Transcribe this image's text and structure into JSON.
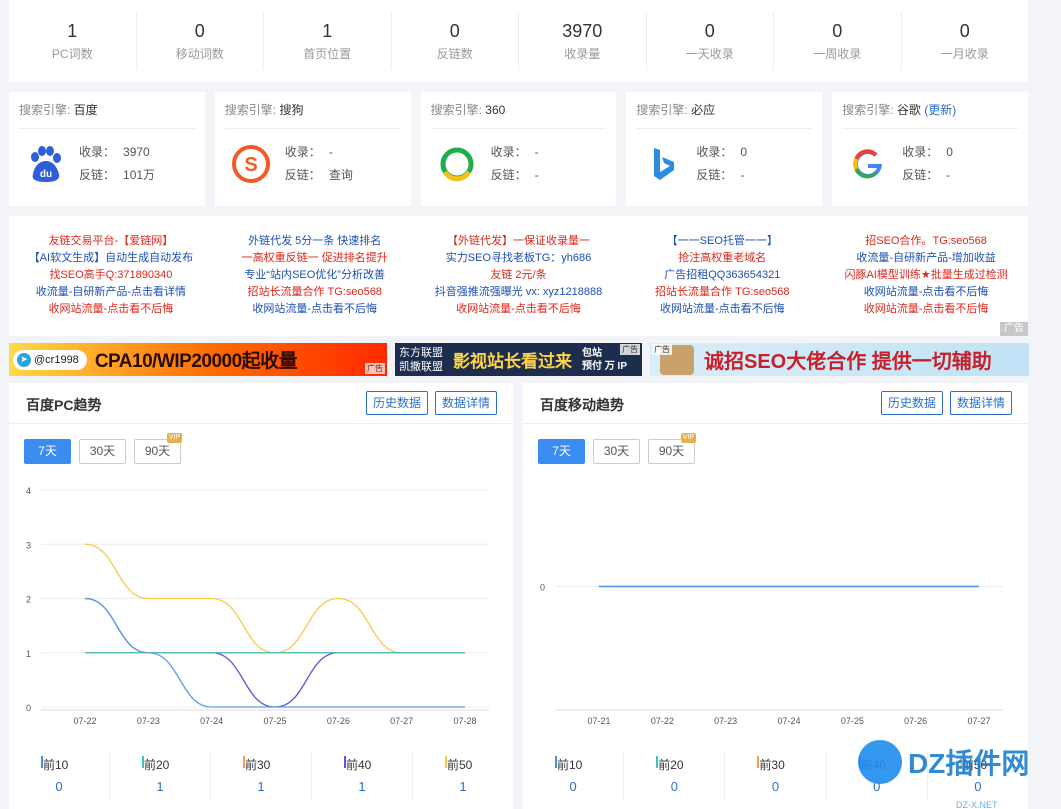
{
  "stats": [
    {
      "value": "1",
      "label": "PC词数"
    },
    {
      "value": "0",
      "label": "移动词数"
    },
    {
      "value": "1",
      "label": "首页位置"
    },
    {
      "value": "0",
      "label": "反链数"
    },
    {
      "value": "3970",
      "label": "收录量"
    },
    {
      "value": "0",
      "label": "一天收录"
    },
    {
      "value": "0",
      "label": "一周收录"
    },
    {
      "value": "0",
      "label": "一月收录"
    }
  ],
  "engines": [
    {
      "prefix": "搜索引擎: ",
      "name": "百度",
      "extra": "",
      "k1": "收录：",
      "v1": "3970",
      "k2": "反链：",
      "v2": "101万",
      "icon": "baidu-icon"
    },
    {
      "prefix": "搜索引擎: ",
      "name": "搜狗",
      "extra": "",
      "k1": "收录：",
      "v1": "-",
      "k2": "反链：",
      "v2": "查询",
      "icon": "sogou-icon"
    },
    {
      "prefix": "搜索引擎: ",
      "name": "360",
      "extra": "",
      "k1": "收录：",
      "v1": "-",
      "k2": "反链：",
      "v2": "-",
      "icon": "so360-icon"
    },
    {
      "prefix": "搜索引擎: ",
      "name": "必应",
      "extra": "",
      "k1": "收录：",
      "v1": "0",
      "k2": "反链：",
      "v2": "-",
      "icon": "bing-icon"
    },
    {
      "prefix": "搜索引擎: ",
      "name": "谷歌",
      "extra": "(更新)",
      "k1": "收录：",
      "v1": "0",
      "k2": "反链：",
      "v2": "-",
      "icon": "google-icon"
    }
  ],
  "ad_columns": [
    [
      "友链交易平台-【爱链网】",
      "【AI软文生成】自动生成自动发布",
      "找SEO高手Q:371890340",
      "收流量-自研新产品-点击看详情",
      "收网站流量-点击看不后悔"
    ],
    [
      "外链代发 5分一条 快速排名",
      "一高权重反链一 促进排名提升",
      "专业“站内SEO优化”分析改善",
      "招站长流量合作 TG:seo568",
      "收网站流量-点击看不后悔"
    ],
    [
      "【外链代发】一保证收录量一",
      "实力SEO寻找老板TG：yh686",
      "友链 2元/条",
      "抖音强推流强曝光 vx: xyz1218888",
      "收网站流量-点击看不后悔"
    ],
    [
      "【一一SEO托管一一】",
      "抢注高权重老域名",
      "广告招租QQ363654321",
      "招站长流量合作 TG:seo568",
      "收网站流量-点击看不后悔"
    ],
    [
      "招SEO合作。TG:seo568",
      "收流量-自研新产品-增加收益",
      "闪豚AI模型训练★批量生成过检测",
      "收网站流量-点击看不后悔",
      "收网站流量-点击看不后悔"
    ]
  ],
  "ad_colors": [
    [
      "#e0261b",
      "#1c4fb4",
      "#e0261b",
      "#1c4fb4",
      "#e0261b"
    ],
    [
      "#1c4fb4",
      "#e0261b",
      "#1c4fb4",
      "#e0261b",
      "#1c4fb4"
    ],
    [
      "#e0261b",
      "#1c4fb4",
      "#e0261b",
      "#1c4fb4",
      "#e0261b"
    ],
    [
      "#1c4fb4",
      "#e0261b",
      "#1c4fb4",
      "#e0261b",
      "#1c4fb4"
    ],
    [
      "#e0261b",
      "#1c4fb4",
      "#e0261b",
      "#1c4fb4",
      "#e0261b"
    ]
  ],
  "ad_tag": "广告",
  "banners": {
    "b1_pill": "@cr1998",
    "b1_text": "CPA10/WIP20000起收量",
    "b1_tag": "广告",
    "b2_left1": "东方联盟",
    "b2_left2": "凯撒联盟",
    "b2_mid": "影视站长看过来",
    "b2_right1": "包站",
    "b2_right2": "预付 万 IP",
    "b2_tag": "广告",
    "b3_text": "诚招SEO大佬合作 提供一切辅助",
    "b3_tag": "广告"
  },
  "panels": [
    {
      "title": "百度PC趋势",
      "btn1": "历史数据",
      "btn2": "数据详情",
      "tabs": [
        "7天",
        "30天",
        "90天"
      ],
      "vip": "VIP",
      "legend": [
        {
          "name": "前10",
          "value": "0",
          "color": "#4a8fe0"
        },
        {
          "name": "前20",
          "value": "1",
          "color": "#40c4b6"
        },
        {
          "name": "前30",
          "value": "1",
          "color": "#f4a14a"
        },
        {
          "name": "前40",
          "value": "1",
          "color": "#5a56d6"
        },
        {
          "name": "前50",
          "value": "1",
          "color": "#f7c94a"
        }
      ]
    },
    {
      "title": "百度移动趋势",
      "btn1": "历史数据",
      "btn2": "数据详情",
      "tabs": [
        "7天",
        "30天",
        "90天"
      ],
      "vip": "VIP",
      "legend": [
        {
          "name": "前10",
          "value": "0",
          "color": "#4a8fe0"
        },
        {
          "name": "前20",
          "value": "0",
          "color": "#40c4b6"
        },
        {
          "name": "前30",
          "value": "0",
          "color": "#f4a14a"
        },
        {
          "name": "前40",
          "value": "0",
          "color": "#5a56d6"
        },
        {
          "name": "前50",
          "value": "0",
          "color": "#f7c94a"
        }
      ]
    }
  ],
  "chart_data": [
    {
      "type": "line",
      "title": "百度PC趋势",
      "x": [
        "07-22",
        "07-23",
        "07-24",
        "07-25",
        "07-26",
        "07-27",
        "07-28"
      ],
      "ylim": [
        0,
        4
      ],
      "yticks": [
        "0",
        "1",
        "2",
        "3",
        "4"
      ],
      "grid": true,
      "series": [
        {
          "name": "前10",
          "color": "#5b9bea",
          "values": [
            2,
            1,
            0,
            0,
            0,
            0,
            0
          ]
        },
        {
          "name": "前20",
          "color": "#40c4b6",
          "values": [
            1,
            1,
            1,
            1,
            1,
            1,
            1
          ]
        },
        {
          "name": "前30",
          "color": "#d4a060",
          "values": [
            1,
            1,
            1,
            1,
            1,
            1,
            1
          ]
        },
        {
          "name": "前40",
          "color": "#5a56d6",
          "values": [
            2,
            1,
            1,
            0,
            1,
            1,
            1
          ]
        },
        {
          "name": "前50",
          "color": "#f7c94a",
          "values": [
            3,
            2,
            2,
            1,
            2,
            1,
            1
          ]
        }
      ]
    },
    {
      "type": "line",
      "title": "百度移动趋势",
      "x": [
        "07-21",
        "07-22",
        "07-23",
        "07-24",
        "07-25",
        "07-26",
        "07-27"
      ],
      "ylim": [
        0,
        0
      ],
      "yticks": [
        "0"
      ],
      "grid": true,
      "series": [
        {
          "name": "前10",
          "color": "#5b9bea",
          "values": [
            0,
            0,
            0,
            0,
            0,
            0,
            0
          ]
        },
        {
          "name": "前20",
          "color": "#40c4b6",
          "values": [
            0,
            0,
            0,
            0,
            0,
            0,
            0
          ]
        },
        {
          "name": "前30",
          "color": "#d4a060",
          "values": [
            0,
            0,
            0,
            0,
            0,
            0,
            0
          ]
        },
        {
          "name": "前40",
          "color": "#5a56d6",
          "values": [
            0,
            0,
            0,
            0,
            0,
            0,
            0
          ]
        },
        {
          "name": "前50",
          "color": "#c7a44f",
          "values": [
            0,
            0,
            0,
            0,
            0,
            0,
            0
          ]
        }
      ]
    }
  ],
  "watermark": {
    "text": "DZ插件网",
    "sub": "DZ-X.NET"
  }
}
